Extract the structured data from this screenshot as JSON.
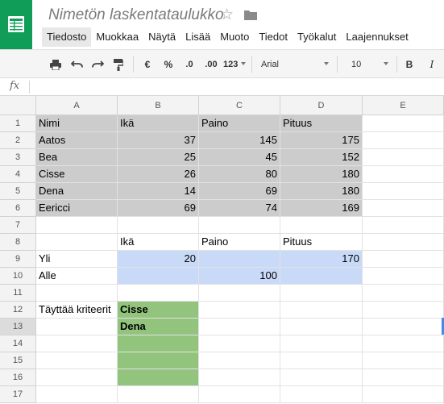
{
  "app": {
    "doc_title": "Nimetön laskentataulukko",
    "accent_color": "#0f9d58"
  },
  "menu": {
    "items": [
      "Tiedosto",
      "Muokkaa",
      "Näytä",
      "Lisää",
      "Muoto",
      "Tiedot",
      "Työkalut",
      "Laajennukset"
    ],
    "active": "Tiedosto"
  },
  "toolbar": {
    "print_icon": "print-icon",
    "undo_icon": "undo-icon",
    "redo_icon": "redo-icon",
    "paint_format_icon": "paint-format-icon",
    "currency": "€",
    "percent": "%",
    "decrease_decimals": ".0",
    "increase_decimals": ".00",
    "more_formats": "123",
    "font": "Arial",
    "font_size": "10",
    "bold": "B",
    "italic": "I"
  },
  "formula_bar": {
    "fx_label": "fx",
    "value": ""
  },
  "columns": [
    "A",
    "B",
    "C",
    "D",
    "E"
  ],
  "rows": [
    "1",
    "2",
    "3",
    "4",
    "5",
    "6",
    "7",
    "8",
    "9",
    "10",
    "11",
    "12",
    "13",
    "14",
    "15",
    "16",
    "17"
  ],
  "cells": {
    "A1": "Nimi",
    "B1": "Ikä",
    "C1": "Paino",
    "D1": "Pituus",
    "A2": "Aatos",
    "B2": "37",
    "C2": "145",
    "D2": "175",
    "A3": "Bea",
    "B3": "25",
    "C3": "45",
    "D3": "152",
    "A4": "Cisse",
    "B4": "26",
    "C4": "80",
    "D4": "180",
    "A5": "Dena",
    "B5": "14",
    "C5": "69",
    "D5": "180",
    "A6": "Eericci",
    "B6": "69",
    "C6": "74",
    "D6": "169",
    "B8": "Ikä",
    "C8": "Paino",
    "D8": "Pituus",
    "A9": "Yli",
    "B9": "20",
    "D9": "170",
    "A10": "Alle",
    "C10": "100",
    "A12": "Täyttää kriteerit",
    "B12": "Cisse",
    "B13": "Dena"
  },
  "colors": {
    "data_fill": "#cccccc",
    "criteria_fill": "#c9daf8",
    "result_fill": "#93c47d",
    "selection": "#4a86e8"
  }
}
